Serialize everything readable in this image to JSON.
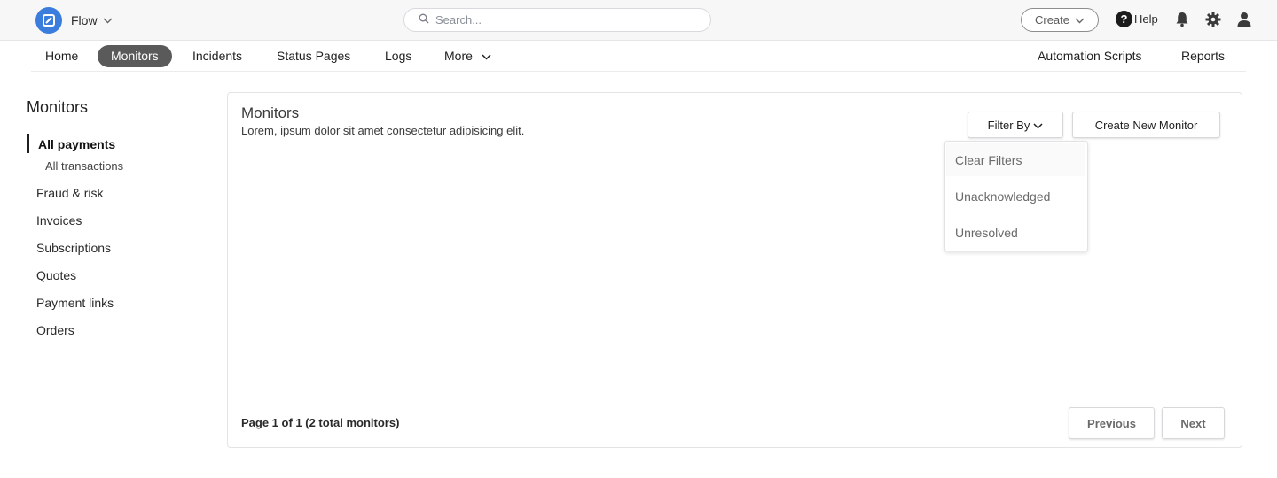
{
  "app": {
    "name": "Flow"
  },
  "search": {
    "placeholder": "Search..."
  },
  "header": {
    "create_label": "Create",
    "help_label": "Help"
  },
  "nav": {
    "left": [
      {
        "label": "Home",
        "active": false
      },
      {
        "label": "Monitors",
        "active": true
      },
      {
        "label": "Incidents",
        "active": false
      },
      {
        "label": "Status Pages",
        "active": false
      },
      {
        "label": "Logs",
        "active": false
      },
      {
        "label": "More",
        "active": false
      }
    ],
    "right": [
      {
        "label": "Automation Scripts"
      },
      {
        "label": "Reports"
      }
    ]
  },
  "sidebar": {
    "title": "Monitors",
    "items": [
      {
        "label": "All payments",
        "active": true
      },
      {
        "label": "All transactions",
        "sub": true
      },
      {
        "label": "Fraud & risk"
      },
      {
        "label": "Invoices"
      },
      {
        "label": "Subscriptions"
      },
      {
        "label": "Quotes"
      },
      {
        "label": "Payment links"
      },
      {
        "label": "Orders"
      }
    ]
  },
  "main": {
    "title": "Monitors",
    "description": "Lorem, ipsum dolor sit amet consectetur adipisicing elit.",
    "filter_label": "Filter By",
    "create_monitor_label": "Create New Monitor",
    "filter_options": [
      "Clear Filters",
      "Unacknowledged",
      "Unresolved"
    ],
    "pagination": {
      "summary": "Page 1 of 1 (2 total monitors)",
      "previous_label": "Previous",
      "next_label": "Next"
    }
  },
  "colors": {
    "brand": "#3b7ddd",
    "active_tab": "#5a5a5a"
  }
}
